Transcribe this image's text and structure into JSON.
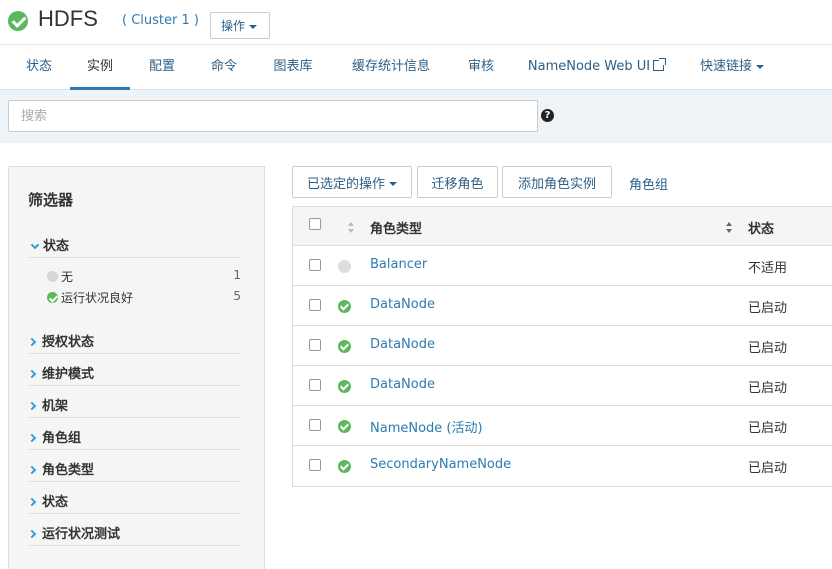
{
  "header": {
    "title": "HDFS",
    "cluster": "( Cluster 1 )",
    "ops_label": "操作"
  },
  "tabs": [
    {
      "label": "状态"
    },
    {
      "label": "实例"
    },
    {
      "label": "配置"
    },
    {
      "label": "命令"
    },
    {
      "label": "图表库"
    },
    {
      "label": "缓存统计信息"
    },
    {
      "label": "审核"
    },
    {
      "label": "NameNode Web UI"
    },
    {
      "label": "快速链接"
    }
  ],
  "search": {
    "placeholder": "搜索",
    "value": ""
  },
  "filters": {
    "title": "筛选器",
    "open_section": {
      "label": "状态",
      "items": [
        {
          "label": "无",
          "count": "1"
        },
        {
          "label": "运行状况良好",
          "count": "5"
        }
      ]
    },
    "sections": [
      {
        "label": "授权状态"
      },
      {
        "label": "维护模式"
      },
      {
        "label": "机架"
      },
      {
        "label": "角色组"
      },
      {
        "label": "角色类型"
      },
      {
        "label": "状态"
      },
      {
        "label": "运行状况测试"
      }
    ]
  },
  "toolbar": {
    "selected_actions": "已选定的操作",
    "migrate_roles": "迁移角色",
    "add_role_instance": "添加角色实例",
    "role_groups": "角色组"
  },
  "table": {
    "headers": {
      "role_type": "角色类型",
      "state": "状态"
    },
    "rows": [
      {
        "health": "none",
        "role": "Balancer",
        "state": "不适用"
      },
      {
        "health": "good",
        "role": "DataNode",
        "state": "已启动"
      },
      {
        "health": "good",
        "role": "DataNode",
        "state": "已启动"
      },
      {
        "health": "good",
        "role": "DataNode",
        "state": "已启动"
      },
      {
        "health": "good",
        "role": "NameNode (活动)",
        "state": "已启动"
      },
      {
        "health": "good",
        "role": "SecondaryNameNode",
        "state": "已启动"
      }
    ]
  },
  "colors": {
    "link": "#2d7bb0",
    "good": "#5cb85c",
    "none": "#d6d6d6",
    "tab_active": "#2d7bb0"
  }
}
